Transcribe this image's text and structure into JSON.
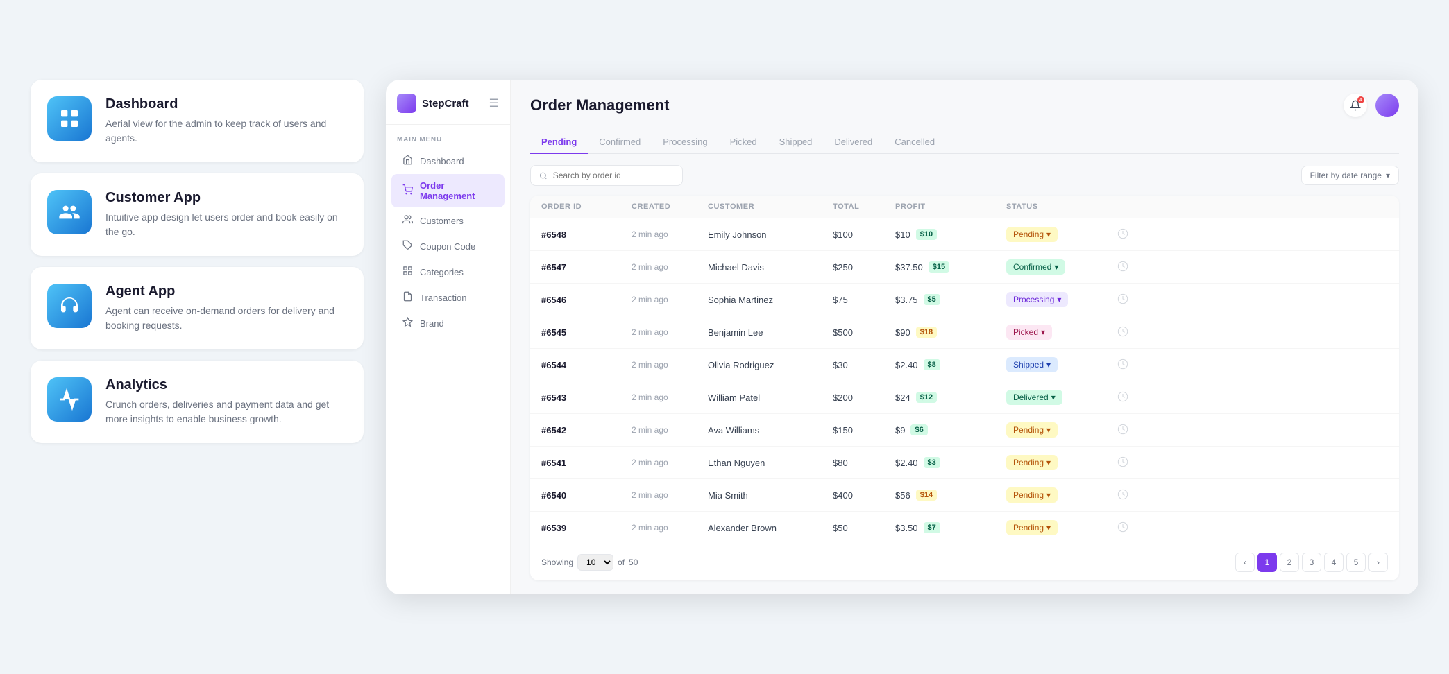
{
  "left": {
    "features": [
      {
        "id": "dashboard",
        "title": "Dashboard",
        "desc": "Aerial view for the admin to keep track of users and agents.",
        "icon": "grid"
      },
      {
        "id": "customer-app",
        "title": "Customer App",
        "desc": "Intuitive app design let users order and book easily on the go.",
        "icon": "users"
      },
      {
        "id": "agent-app",
        "title": "Agent App",
        "desc": "Agent can receive on-demand orders for delivery and booking requests.",
        "icon": "headset"
      },
      {
        "id": "analytics",
        "title": "Analytics",
        "desc": "Crunch orders, deliveries and payment data and get more insights to enable business growth.",
        "icon": "chart"
      }
    ]
  },
  "app": {
    "brand": "StepCraft",
    "menu_label": "MAIN MENU",
    "sidebar_items": [
      {
        "id": "dashboard",
        "label": "Dashboard",
        "icon": "home"
      },
      {
        "id": "order-management",
        "label": "Order Management",
        "icon": "cart",
        "active": true
      },
      {
        "id": "customers",
        "label": "Customers",
        "icon": "users"
      },
      {
        "id": "coupon-code",
        "label": "Coupon Code",
        "icon": "tag"
      },
      {
        "id": "categories",
        "label": "Categories",
        "icon": "grid"
      },
      {
        "id": "transaction",
        "label": "Transaction",
        "icon": "doc"
      },
      {
        "id": "brand",
        "label": "Brand",
        "icon": "star"
      }
    ],
    "page_title": "Order Management",
    "tabs": [
      {
        "id": "pending",
        "label": "Pending",
        "active": true
      },
      {
        "id": "confirmed",
        "label": "Confirmed"
      },
      {
        "id": "processing",
        "label": "Processing"
      },
      {
        "id": "picked",
        "label": "Picked"
      },
      {
        "id": "shipped",
        "label": "Shipped"
      },
      {
        "id": "delivered",
        "label": "Delivered"
      },
      {
        "id": "cancelled",
        "label": "Cancelled"
      }
    ],
    "search_placeholder": "Search by order id",
    "filter_label": "Filter by date range",
    "table": {
      "headers": [
        "ORDER ID",
        "CREATED",
        "CUSTOMER",
        "TOTAL",
        "PROFIT",
        "STATUS",
        ""
      ],
      "rows": [
        {
          "id": "#6548",
          "created": "2 min ago",
          "customer": "Emily Johnson",
          "total": "$100",
          "profit": "$10",
          "profit_badge": "$10",
          "profit_color": "#d1fae5",
          "profit_text": "#065f46",
          "status": "Pending",
          "status_class": "status-pending"
        },
        {
          "id": "#6547",
          "created": "2 min ago",
          "customer": "Michael Davis",
          "total": "$250",
          "profit": "$37.50",
          "profit_badge": "$15",
          "profit_color": "#d1fae5",
          "profit_text": "#065f46",
          "status": "Confirmed",
          "status_class": "status-confirmed"
        },
        {
          "id": "#6546",
          "created": "2 min ago",
          "customer": "Sophia Martinez",
          "total": "$75",
          "profit": "$3.75",
          "profit_badge": "$5",
          "profit_color": "#d1fae5",
          "profit_text": "#065f46",
          "status": "Processing",
          "status_class": "status-processing"
        },
        {
          "id": "#6545",
          "created": "2 min ago",
          "customer": "Benjamin Lee",
          "total": "$500",
          "profit": "$90",
          "profit_badge": "$18",
          "profit_color": "#fef9c3",
          "profit_text": "#b45309",
          "status": "Picked",
          "status_class": "status-picked"
        },
        {
          "id": "#6544",
          "created": "2 min ago",
          "customer": "Olivia Rodriguez",
          "total": "$30",
          "profit": "$2.40",
          "profit_badge": "$8",
          "profit_color": "#d1fae5",
          "profit_text": "#065f46",
          "status": "Shipped",
          "status_class": "status-shipped"
        },
        {
          "id": "#6543",
          "created": "2 min ago",
          "customer": "William Patel",
          "total": "$200",
          "profit": "$24",
          "profit_badge": "$12",
          "profit_color": "#d1fae5",
          "profit_text": "#065f46",
          "status": "Delivered",
          "status_class": "status-delivered"
        },
        {
          "id": "#6542",
          "created": "2 min ago",
          "customer": "Ava Williams",
          "total": "$150",
          "profit": "$9",
          "profit_badge": "$6",
          "profit_color": "#d1fae5",
          "profit_text": "#065f46",
          "status": "Pending",
          "status_class": "status-pending"
        },
        {
          "id": "#6541",
          "created": "2 min ago",
          "customer": "Ethan Nguyen",
          "total": "$80",
          "profit": "$2.40",
          "profit_badge": "$3",
          "profit_color": "#d1fae5",
          "profit_text": "#065f46",
          "status": "Pending",
          "status_class": "status-pending"
        },
        {
          "id": "#6540",
          "created": "2 min ago",
          "customer": "Mia Smith",
          "total": "$400",
          "profit": "$56",
          "profit_badge": "$14",
          "profit_color": "#fef9c3",
          "profit_text": "#b45309",
          "status": "Pending",
          "status_class": "status-pending"
        },
        {
          "id": "#6539",
          "created": "2 min ago",
          "customer": "Alexander Brown",
          "total": "$50",
          "profit": "$3.50",
          "profit_badge": "$7",
          "profit_color": "#d1fae5",
          "profit_text": "#065f46",
          "status": "Pending",
          "status_class": "status-pending"
        }
      ]
    },
    "pagination": {
      "showing_label": "Showing",
      "per_page": "10",
      "of_label": "of",
      "total": "50",
      "pages": [
        "1",
        "2",
        "3",
        "4",
        "5"
      ],
      "current_page": "1"
    }
  }
}
